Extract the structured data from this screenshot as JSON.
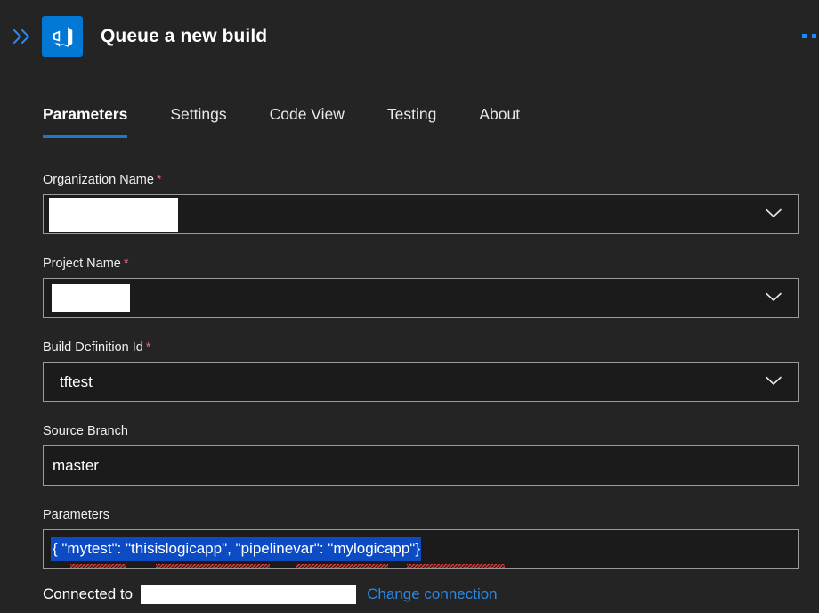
{
  "window": {
    "title": "Queue a new build",
    "expand_icon": "double-chevron-right-icon",
    "app_icon": "azure-devops-icon",
    "overflow_icon": "ellipsis-icon"
  },
  "tabs": [
    {
      "label": "Parameters",
      "active": true
    },
    {
      "label": "Settings",
      "active": false
    },
    {
      "label": "Code View",
      "active": false
    },
    {
      "label": "Testing",
      "active": false
    },
    {
      "label": "About",
      "active": false
    }
  ],
  "fields": [
    {
      "label": "Organization Name",
      "required": true,
      "required_marker": "*",
      "type": "dropdown",
      "value": "",
      "redacted": true,
      "chevron_icon": "chevron-down-icon"
    },
    {
      "label": "Project Name",
      "required": true,
      "required_marker": "*",
      "type": "dropdown",
      "value": "",
      "redacted": true,
      "chevron_icon": "chevron-down-icon"
    },
    {
      "label": "Build Definition Id",
      "required": true,
      "required_marker": "*",
      "type": "dropdown",
      "value": "tftest",
      "redacted": false,
      "chevron_icon": "chevron-down-icon"
    },
    {
      "label": "Source Branch",
      "required": false,
      "required_marker": "",
      "type": "text",
      "value": "master",
      "redacted": false
    },
    {
      "label": "Parameters",
      "required": false,
      "required_marker": "",
      "type": "text-selected",
      "value": "{ \"mytest\": \"thisislogicapp\", \"pipelinevar\": \"mylogicapp\"}",
      "redacted": false
    }
  ],
  "footer": {
    "connected_label": "Connected to",
    "connection_name": "",
    "change_connection_label": "Change connection"
  },
  "colors": {
    "page_background": "#242424",
    "field_background": "#1b1b1b",
    "field_border": "#9a9a9a",
    "accent_blue": "#1a79cf",
    "link_blue": "#2b88e0",
    "logo_blue": "#0078d4",
    "required_red": "#e06c75",
    "selection_blue": "#0c4bc4",
    "spellcheck_red": "#e03c31",
    "redaction_white": "#ffffff"
  }
}
